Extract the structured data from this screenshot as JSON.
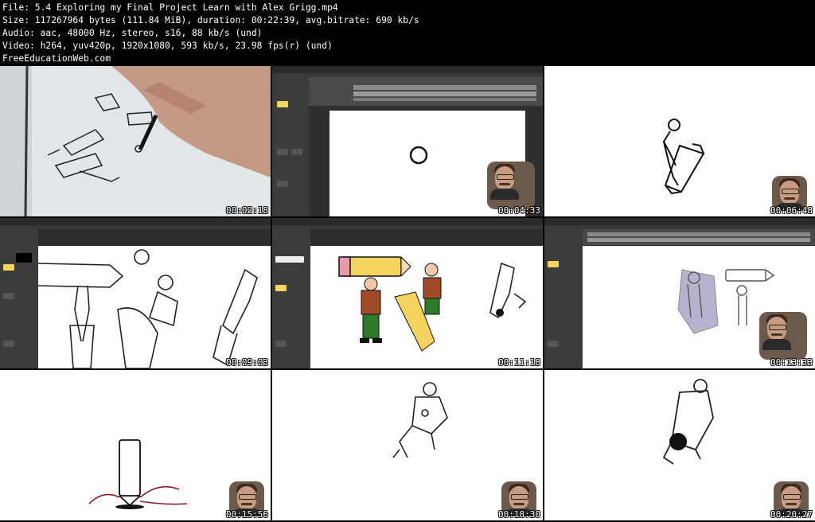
{
  "info": {
    "file": "File: 5.4 Exploring my Final Project Learn with Alex Grigg.mp4",
    "size": "Size: 117267964 bytes (111.84 MiB), duration: 00:22:39, avg.bitrate: 690 kb/s",
    "audio": "Audio: aac, 48000 Hz, stereo, s16, 88 kb/s (und)",
    "video": "Video: h264, yuv420p, 1920x1080, 593 kb/s, 23.98 fps(r) (und)",
    "site": "FreeEducationWeb.com"
  },
  "thumbnails": [
    {
      "timestamp": "00:02:18",
      "scene": "pen-drawing-photo"
    },
    {
      "timestamp": "00:04:33",
      "scene": "app-circle"
    },
    {
      "timestamp": "00:06:48",
      "scene": "pencil-figure-sketch"
    },
    {
      "timestamp": "00:09:03",
      "scene": "app-sketches"
    },
    {
      "timestamp": "00:11:18",
      "scene": "app-colored-characters"
    },
    {
      "timestamp": "00:13:33",
      "scene": "app-onion-skin"
    },
    {
      "timestamp": "00:15:56",
      "scene": "pencil-impact"
    },
    {
      "timestamp": "00:18:30",
      "scene": "rolling-figure"
    },
    {
      "timestamp": "00:20:27",
      "scene": "rolling-figure-ink"
    }
  ],
  "colors": {
    "background": "#000000",
    "text": "#ffffff",
    "app_dark": "#3c3c3c",
    "accent_yellow": "#f4d35e",
    "accent_red": "#8b1e1e"
  }
}
